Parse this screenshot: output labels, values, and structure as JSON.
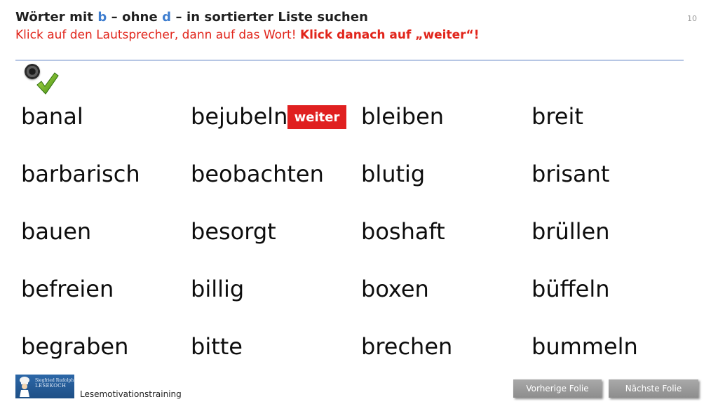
{
  "header": {
    "title_prefix": "Wörter mit ",
    "title_b": "b",
    "title_mid": " – ohne ",
    "title_d": "d",
    "title_suffix": " – in sortierter Liste suchen",
    "instruction": "Klick auf den Lautsprecher, dann auf das Wort! ",
    "instruction_bold": "Klick danach auf „weiter“!",
    "slide_number": "10"
  },
  "icons": {
    "speaker": "speaker-icon",
    "check": "checkmark-icon"
  },
  "words": {
    "col1": [
      "banal",
      "barbarisch",
      "bauen",
      "befreien",
      "begraben"
    ],
    "col2": [
      "bejubeln",
      "beobachten",
      "besorgt",
      "billig",
      "bitte"
    ],
    "col3": [
      "bleiben",
      "blutig",
      "boshaft",
      "boxen",
      "brechen"
    ],
    "col4": [
      "breit",
      "brisant",
      "brüllen",
      "büffeln",
      "bummeln"
    ]
  },
  "weiter_label": "weiter",
  "footer": {
    "logo_small": "Siegfried Rudolph",
    "logo_brand": "LESEKOCH",
    "label": "Lesemotivationstraining",
    "prev_label": "Vorherige  Folie",
    "next_label": "Nächste  Folie"
  },
  "colors": {
    "accent_blue": "#3d7dcf",
    "accent_red": "#e1251b",
    "button_red": "#e02020",
    "divider": "#b6c6e4",
    "nav_button": "#9a9a9a"
  }
}
